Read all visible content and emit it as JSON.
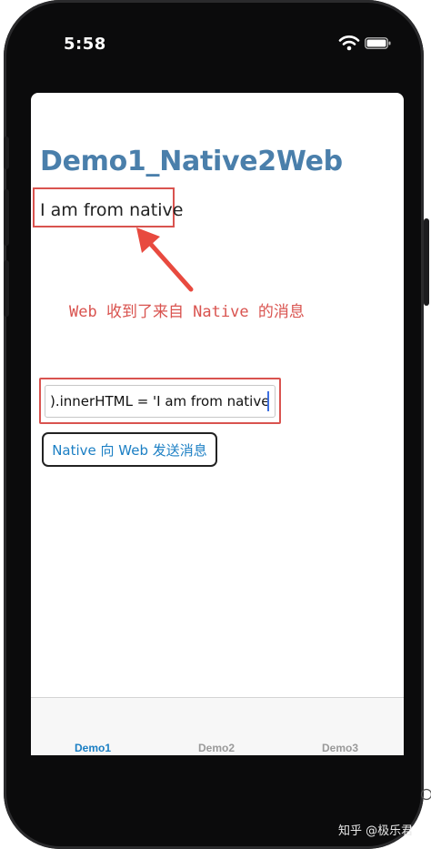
{
  "status_bar": {
    "time": "5:58"
  },
  "page": {
    "title": "Demo1_Native2Web",
    "received_message": "I am from native",
    "annotation": "Web 收到了来自 Native 的消息"
  },
  "input": {
    "value": ").innerHTML = 'I am from native';"
  },
  "send_button": {
    "label": "Native 向 Web 发送消息"
  },
  "tabs": [
    {
      "label": "Demo1",
      "active": true
    },
    {
      "label": "Demo2",
      "active": false
    },
    {
      "label": "Demo3",
      "active": false
    }
  ],
  "watermark": {
    "text": "知乎 @极乐君"
  },
  "colors": {
    "title": "#4a7fab",
    "highlight": "#d9534f",
    "accent": "#1b7fc4",
    "tab_inactive": "#9a9a9a"
  },
  "icons": [
    "wifi-icon",
    "battery-icon",
    "arrow-icon"
  ]
}
